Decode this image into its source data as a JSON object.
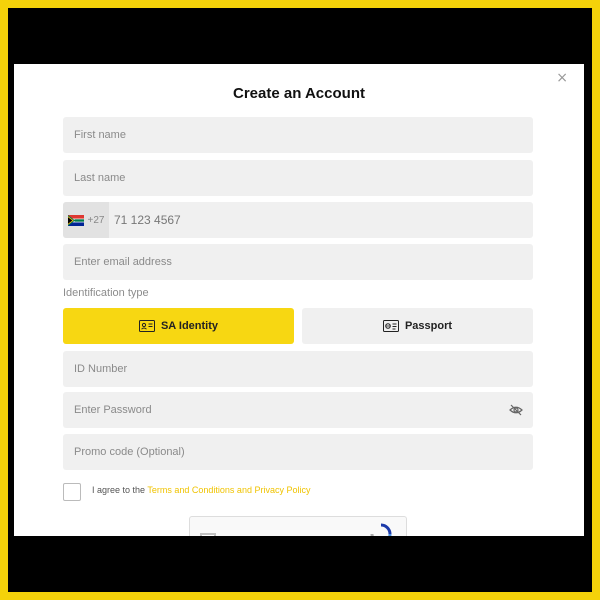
{
  "modal": {
    "close_icon": "×",
    "title": "Create an Account"
  },
  "fields": {
    "first_name_placeholder": "First name",
    "last_name_placeholder": "Last name",
    "phone_country": "South Africa",
    "phone_dial_code": "+27",
    "phone_placeholder": "71 123 4567",
    "email_placeholder": "Enter email address",
    "id_number_placeholder": "ID Number",
    "password_placeholder": "Enter Password",
    "promo_placeholder": "Promo code (Optional)"
  },
  "identification": {
    "label": "Identification type",
    "options": [
      {
        "label": "SA Identity",
        "icon": "id-card-icon",
        "selected": true
      },
      {
        "label": "Passport",
        "icon": "passport-icon",
        "selected": false
      }
    ]
  },
  "terms": {
    "prefix": "I agree to the",
    "link_text": "Terms and Conditions and Privacy Policy",
    "checked": false
  },
  "colors": {
    "accent": "#f7d712",
    "frame": "#f5d20a",
    "field_bg": "#f0f0f0",
    "link": "#f0c300"
  }
}
